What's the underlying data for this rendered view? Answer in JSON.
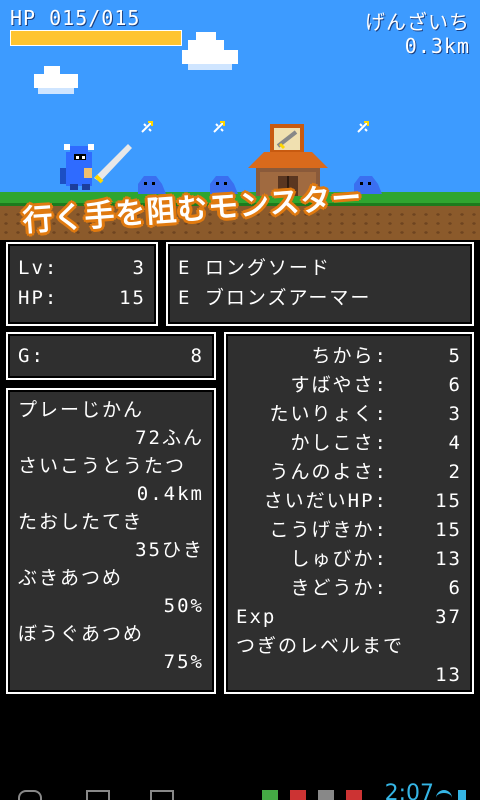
{
  "hud": {
    "hp": "HP 015/015",
    "hp_fraction": 1.0,
    "location": "げんざいち",
    "distance": "0.3km"
  },
  "message": "行く手を阻むモンスター",
  "level_panel": {
    "rows": [
      {
        "label": "Lv:",
        "value": "3"
      },
      {
        "label": "HP:",
        "value": "15"
      }
    ]
  },
  "equipment": {
    "rows": [
      "E ロングソード",
      "E ブロンズアーマー"
    ]
  },
  "gold": {
    "label": "G:",
    "value": "8"
  },
  "progress": {
    "rows": [
      {
        "label": "プレーじかん",
        "value": "72ふん"
      },
      {
        "label": "さいこうとうたつ",
        "value": "0.4km"
      },
      {
        "label": "たおしたてき",
        "value": "35ひき"
      },
      {
        "label": "ぶきあつめ",
        "value": "50%"
      },
      {
        "label": "ぼうぐあつめ",
        "value": "75%"
      }
    ]
  },
  "stats": {
    "rows": [
      {
        "label": "ちから:",
        "value": "5"
      },
      {
        "label": "すばやさ:",
        "value": "6"
      },
      {
        "label": "たいりょく:",
        "value": "3"
      },
      {
        "label": "かしこさ:",
        "value": "4"
      },
      {
        "label": "うんのよさ:",
        "value": "2"
      },
      {
        "label": "さいだいHP:",
        "value": "15"
      },
      {
        "label": "こうげきか:",
        "value": "15"
      },
      {
        "label": "しゅびか:",
        "value": "13"
      },
      {
        "label": "きどうか:",
        "value": "6"
      },
      {
        "label": "Exp",
        "value": "37"
      }
    ],
    "next_label": "つぎのレベルまで",
    "next_value": "13"
  },
  "status_bar": {
    "clock": "2:07"
  },
  "colors": {
    "sky": "#3d9bff",
    "hp_bar": "#ffc430",
    "panel": "#2f2f2f",
    "accent": "#35b5e5"
  }
}
